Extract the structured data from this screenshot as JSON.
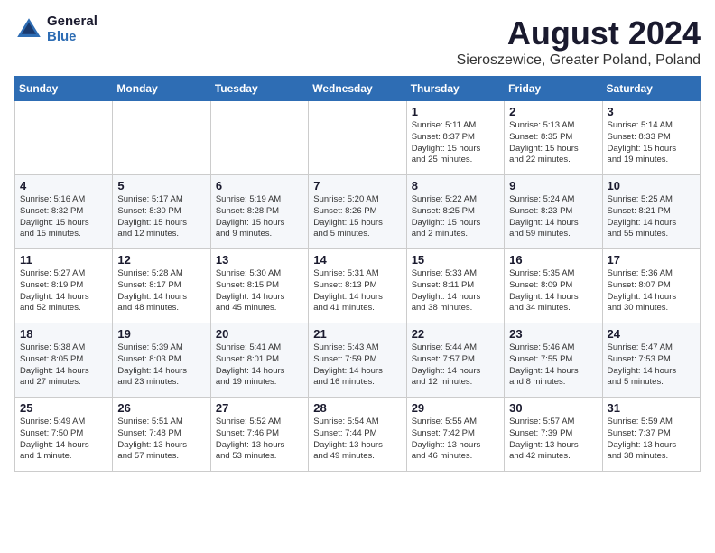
{
  "logo": {
    "general": "General",
    "blue": "Blue"
  },
  "title": "August 2024",
  "subtitle": "Sieroszewice, Greater Poland, Poland",
  "days_of_week": [
    "Sunday",
    "Monday",
    "Tuesday",
    "Wednesday",
    "Thursday",
    "Friday",
    "Saturday"
  ],
  "weeks": [
    [
      {
        "num": "",
        "info": ""
      },
      {
        "num": "",
        "info": ""
      },
      {
        "num": "",
        "info": ""
      },
      {
        "num": "",
        "info": ""
      },
      {
        "num": "1",
        "info": "Sunrise: 5:11 AM\nSunset: 8:37 PM\nDaylight: 15 hours\nand 25 minutes."
      },
      {
        "num": "2",
        "info": "Sunrise: 5:13 AM\nSunset: 8:35 PM\nDaylight: 15 hours\nand 22 minutes."
      },
      {
        "num": "3",
        "info": "Sunrise: 5:14 AM\nSunset: 8:33 PM\nDaylight: 15 hours\nand 19 minutes."
      }
    ],
    [
      {
        "num": "4",
        "info": "Sunrise: 5:16 AM\nSunset: 8:32 PM\nDaylight: 15 hours\nand 15 minutes."
      },
      {
        "num": "5",
        "info": "Sunrise: 5:17 AM\nSunset: 8:30 PM\nDaylight: 15 hours\nand 12 minutes."
      },
      {
        "num": "6",
        "info": "Sunrise: 5:19 AM\nSunset: 8:28 PM\nDaylight: 15 hours\nand 9 minutes."
      },
      {
        "num": "7",
        "info": "Sunrise: 5:20 AM\nSunset: 8:26 PM\nDaylight: 15 hours\nand 5 minutes."
      },
      {
        "num": "8",
        "info": "Sunrise: 5:22 AM\nSunset: 8:25 PM\nDaylight: 15 hours\nand 2 minutes."
      },
      {
        "num": "9",
        "info": "Sunrise: 5:24 AM\nSunset: 8:23 PM\nDaylight: 14 hours\nand 59 minutes."
      },
      {
        "num": "10",
        "info": "Sunrise: 5:25 AM\nSunset: 8:21 PM\nDaylight: 14 hours\nand 55 minutes."
      }
    ],
    [
      {
        "num": "11",
        "info": "Sunrise: 5:27 AM\nSunset: 8:19 PM\nDaylight: 14 hours\nand 52 minutes."
      },
      {
        "num": "12",
        "info": "Sunrise: 5:28 AM\nSunset: 8:17 PM\nDaylight: 14 hours\nand 48 minutes."
      },
      {
        "num": "13",
        "info": "Sunrise: 5:30 AM\nSunset: 8:15 PM\nDaylight: 14 hours\nand 45 minutes."
      },
      {
        "num": "14",
        "info": "Sunrise: 5:31 AM\nSunset: 8:13 PM\nDaylight: 14 hours\nand 41 minutes."
      },
      {
        "num": "15",
        "info": "Sunrise: 5:33 AM\nSunset: 8:11 PM\nDaylight: 14 hours\nand 38 minutes."
      },
      {
        "num": "16",
        "info": "Sunrise: 5:35 AM\nSunset: 8:09 PM\nDaylight: 14 hours\nand 34 minutes."
      },
      {
        "num": "17",
        "info": "Sunrise: 5:36 AM\nSunset: 8:07 PM\nDaylight: 14 hours\nand 30 minutes."
      }
    ],
    [
      {
        "num": "18",
        "info": "Sunrise: 5:38 AM\nSunset: 8:05 PM\nDaylight: 14 hours\nand 27 minutes."
      },
      {
        "num": "19",
        "info": "Sunrise: 5:39 AM\nSunset: 8:03 PM\nDaylight: 14 hours\nand 23 minutes."
      },
      {
        "num": "20",
        "info": "Sunrise: 5:41 AM\nSunset: 8:01 PM\nDaylight: 14 hours\nand 19 minutes."
      },
      {
        "num": "21",
        "info": "Sunrise: 5:43 AM\nSunset: 7:59 PM\nDaylight: 14 hours\nand 16 minutes."
      },
      {
        "num": "22",
        "info": "Sunrise: 5:44 AM\nSunset: 7:57 PM\nDaylight: 14 hours\nand 12 minutes."
      },
      {
        "num": "23",
        "info": "Sunrise: 5:46 AM\nSunset: 7:55 PM\nDaylight: 14 hours\nand 8 minutes."
      },
      {
        "num": "24",
        "info": "Sunrise: 5:47 AM\nSunset: 7:53 PM\nDaylight: 14 hours\nand 5 minutes."
      }
    ],
    [
      {
        "num": "25",
        "info": "Sunrise: 5:49 AM\nSunset: 7:50 PM\nDaylight: 14 hours\nand 1 minute."
      },
      {
        "num": "26",
        "info": "Sunrise: 5:51 AM\nSunset: 7:48 PM\nDaylight: 13 hours\nand 57 minutes."
      },
      {
        "num": "27",
        "info": "Sunrise: 5:52 AM\nSunset: 7:46 PM\nDaylight: 13 hours\nand 53 minutes."
      },
      {
        "num": "28",
        "info": "Sunrise: 5:54 AM\nSunset: 7:44 PM\nDaylight: 13 hours\nand 49 minutes."
      },
      {
        "num": "29",
        "info": "Sunrise: 5:55 AM\nSunset: 7:42 PM\nDaylight: 13 hours\nand 46 minutes."
      },
      {
        "num": "30",
        "info": "Sunrise: 5:57 AM\nSunset: 7:39 PM\nDaylight: 13 hours\nand 42 minutes."
      },
      {
        "num": "31",
        "info": "Sunrise: 5:59 AM\nSunset: 7:37 PM\nDaylight: 13 hours\nand 38 minutes."
      }
    ]
  ]
}
